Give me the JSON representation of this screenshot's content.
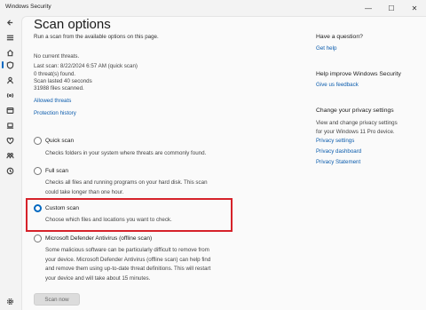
{
  "window": {
    "title": "Windows Security",
    "minimize_glyph": "—",
    "maximize_glyph": "☐",
    "close_glyph": "✕"
  },
  "nav": {
    "icons": [
      "back-arrow-icon",
      "menu-icon",
      "home-icon",
      "shield-icon",
      "person-icon",
      "wireless-icon",
      "browser-icon",
      "laptop-icon",
      "heart-icon",
      "family-icon",
      "history-icon",
      "gear-icon"
    ]
  },
  "page": {
    "title": "Scan options",
    "subtitle": "Run a scan from the available options on this page.",
    "status": {
      "threats": "No current threats.",
      "last_scan": "Last scan: 8/22/2024 6:57 AM (quick scan)",
      "threats_found": "0 threat(s) found.",
      "duration": "Scan lasted 40 seconds",
      "files_scanned": "31988 files scanned."
    },
    "links": {
      "allowed_threats": "Allowed threats",
      "protection_history": "Protection history"
    },
    "options": [
      {
        "label": "Quick scan",
        "desc": [
          "Checks folders in your system where threats are commonly found."
        ],
        "checked": false
      },
      {
        "label": "Full scan",
        "desc": [
          "Checks all files and running programs on your hard disk. This scan",
          "could take longer than one hour."
        ],
        "checked": false
      },
      {
        "label": "Custom scan",
        "desc": [
          "Choose which files and locations you want to check."
        ],
        "checked": true
      },
      {
        "label": "Microsoft Defender Antivirus (offline scan)",
        "desc": [
          "Some malicious software can be particularly difficult to remove from",
          "your device. Microsoft Defender Antivirus (offline scan) can help find",
          "and remove them using up-to-date threat definitions. This will restart",
          "your device and will take about 15 minutes."
        ],
        "checked": false
      }
    ],
    "scan_button": "Scan now"
  },
  "side": {
    "question": {
      "heading": "Have a question?",
      "link": "Get help"
    },
    "improve": {
      "heading": "Help improve Windows Security",
      "link": "Give us feedback"
    },
    "privacy": {
      "heading": "Change your privacy settings",
      "text": [
        "View and change privacy settings",
        "for your Windows 11 Pro device."
      ],
      "links": [
        "Privacy settings",
        "Privacy dashboard",
        "Privacy Statement"
      ]
    }
  },
  "colors": {
    "accent": "#0067c0",
    "link": "#0b5cad",
    "highlight": "#d6222a"
  }
}
